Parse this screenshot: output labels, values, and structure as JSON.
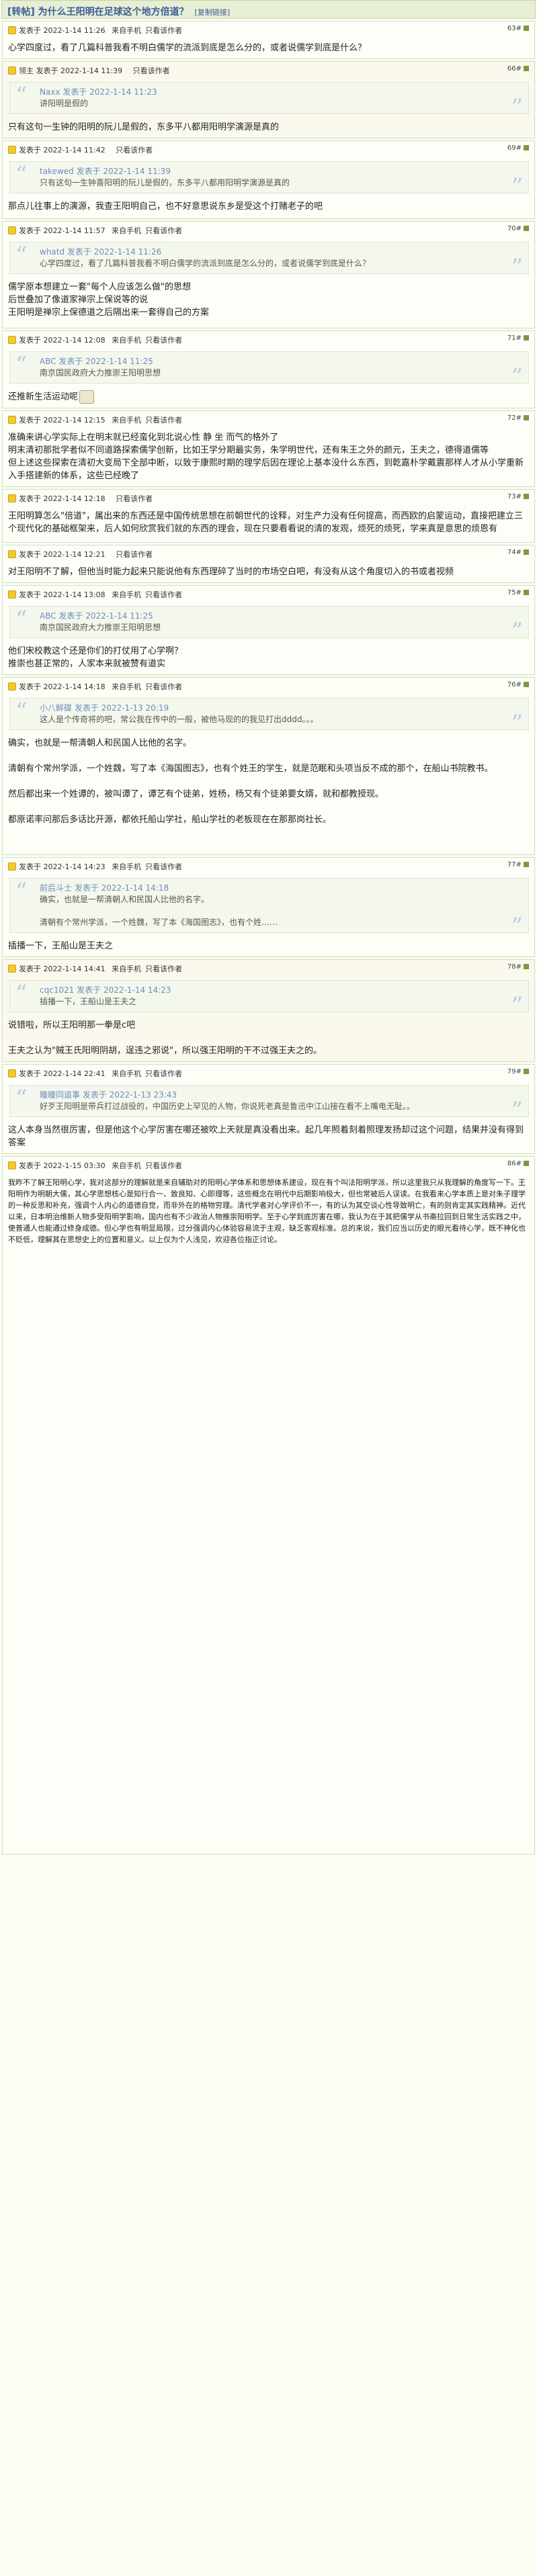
{
  "page": {
    "title": "[转帖] 为什么王阳明在足球这个地方倍道？",
    "copy_label": "[复制链接]"
  },
  "posts": [
    {
      "author": "发表于 2022-1-14 11:26",
      "device": "来自手机",
      "views": "只看该作者",
      "floor": "63#",
      "body": "心学四度过，看了几篇科普我看不明白儒学的流派到底是怎么分的，或者说儒学到底是什么？"
    },
    {
      "author": "领主 发表于 2022-1-14 11:39",
      "device": "",
      "views": "只看该作者",
      "floor": "66#",
      "quote_head": "Naxx 发表于 2022-1-14 11:23",
      "quote": "讲阳明是假的",
      "body": "只有这句一生钟的阳明的阮儿是假的，东多平八都用阳明学演源是真的"
    },
    {
      "author": "发表于 2022-1-14 11:42",
      "device": "",
      "views": "只看该作者",
      "floor": "69#",
      "quote_head": "takewed 发表于 2022-1-14 11:39",
      "quote": "只有这句一生钟喜阳明的阮儿是假的，东多平八都用阳明学演源是真的",
      "body": "那点儿往事上的演源，我查王阳明自己，也不好意思说东乡是受这个打赌老子的吧"
    },
    {
      "author": "发表于 2022-1-14 11:57",
      "device": "来自手机",
      "views": "只看该作者",
      "floor": "70#",
      "quote_head": "whatd 发表于 2022-1-14 11:26",
      "quote": "心学四度过，看了几篇科普我看不明白儒学的流派到底是怎么分的，或者说儒学到底是什么？",
      "body": "儒学原本想建立一套\"每个人应该怎么做\"的思想\n后世叠加了像道家禅宗上保说等的说\n王阳明是禅宗上保德道之后隔出来一套得自己的方案"
    },
    {
      "author": "发表于 2022-1-14 12:08",
      "device": "来自手机",
      "views": "只看该作者",
      "floor": "71#",
      "quote_head": "ABC 发表于 2022-1-14 11:25",
      "quote": "南京国民政府大力推崇王阳明思想",
      "body": "还推新生活运动呢"
    },
    {
      "author": "发表于 2022-1-14 12:15",
      "device": "来自手机",
      "views": "只看该作者",
      "floor": "72#",
      "body": "准确来讲心学实际上在明末就已经蛮化到北说心性 静 坐 而气的格外了\n明末清初那批学者似不同道路探索儒学创新，比如王学分期最实务，朱学明世代，还有朱王之外的颜元，王夫之，德得道儒等\n但上述这些探索在清初大变局下全部中断，以致于康熙时期的理学后因在理论上基本没什么东西，到乾嘉朴学戴震那样人才从小学重新入手搭建新的体系，这些已经晚了"
    },
    {
      "author": "发表于 2022-1-14 12:18",
      "device": "",
      "views": "只看该作者",
      "floor": "73#",
      "body": "王阳明算怎么\"倍道\"，属出来的东西还是中国传统思想在前朝世代的诠释，对生产力没有任何提高，而西欧的启蒙运动，直接把建立三个现代化的基础框架来，后人如何欣赏我们就的东西的理会，现在只要看看说的清的发观，烦死的烦死，学来真是意思的烦恩有"
    },
    {
      "author": "发表于 2022-1-14 12:21",
      "device": "",
      "views": "只看该作者",
      "floor": "74#",
      "body": "对王阳明不了解，但他当时能力起来只能说他有东西理碎了当时的市场空白吧，有没有从这个角度切入的书或者视频"
    },
    {
      "author": "发表于 2022-1-14 13:08",
      "device": "来自手机",
      "views": "只看该作者",
      "floor": "75#",
      "quote_head": "ABC 发表于 2022-1-14 11:25",
      "quote": "南京国民政府大力推崇王阳明思想",
      "body": "他们宋校教这个还是你们的打仗用了心学啊？\n推崇也甚正常的，人家本来就被赞有道实"
    },
    {
      "author": "发表于 2022-1-14 14:18",
      "device": "来自手机",
      "views": "只看该作者",
      "floor": "76#",
      "quote_head": "小八鲜碟 发表于 2022-1-13 20:19",
      "quote": "这人是个传奇将的吧，常公我在传中的一般，被他马现的的我见打出dddd。。。",
      "body": "确实，也就是一帮清朝人和民国人比他的名字。\n\n清朝有个常州学派，一个姓魏，写了本《海国图志》，也有个姓王的学生，就是范眠和头项当反不成的那个，在船山书院教书。\n\n然后都出来一个姓谭的，被叫谭了，谭艺有个徒弟，姓杨，杨又有个徒弟要女婿，就和都教授现。\n\n都原诺率问那后多话比开源，都依托船山学社，船山学社的老板现在在那那岗社长。"
    },
    {
      "author": "发表于 2022-1-14 14:23",
      "device": "来自手机",
      "views": "只看该作者",
      "floor": "77#",
      "quote_head": "前后斗士 发表于 2022-1-14 14:18",
      "quote": "确实，也就是一帮清朝人和民国人比他的名字。\n\n清朝有个常州学派，一个姓魏，写了本《海国图志》，也有个姓……",
      "body": "插播一下，王船山是王夫之"
    },
    {
      "author": "发表于 2022-1-14 14:41",
      "device": "来自手机",
      "views": "只看该作者",
      "floor": "78#",
      "quote_head": "cqc1021 发表于 2022-1-14 14:23",
      "quote": "插播一下，王船山是王夫之",
      "body": "说错啦，所以王阳明那一拳是c吧\n\n王夫之认为\"贼王氏阳明阴胡，逞违之邪说\"，所以强王阳明的干不过强王夫之的。"
    },
    {
      "author": "发表于 2022-1-14 22:41",
      "device": "来自手机",
      "views": "只看该作者",
      "floor": "79#",
      "quote_head": "瞳瞳同道事 发表于 2022-1-13 23:43",
      "quote": "好歹王阳明是带兵打过战役的，中国历史上罕见的人物，你说死老真是鲁迅中江山接在看不上嘴电无耻。。",
      "body": "这人本身当然很厉害，但是他这个心学厉害在哪还被吹上天就是真没看出来。起几年照着刻着照理发扬却过这个问题，结果并没有得到答案"
    },
    {
      "author": "发表于 2022-1-15 03:30",
      "device": "来自手机",
      "views": "只看该作者",
      "floor": "86#",
      "body": "我昨不了解王阳明心学，我对这部分的理解就是来自辅助对的阳明心学体系和思想体系建设，现在有个叫法阳明学派，所以这里我只从我理解的角度写一下。王阳明作为明朝大儒，其心学思想核心是知行合一、致良知、心即理等，这些概念在明代中后期影响极大，但也常被后人误读。在我看来心学本质上是对朱子理学的一种反思和补充，强调个人内心的道德自觉，而非外在的格物穷理。清代学者对心学评价不一，有的认为其空谈心性导致明亡，有的则肯定其实践精神。近代以来，日本明治维新人物多受阳明学影响，国内也有不少政治人物推崇阳明学。至于心学到底厉害在哪，我认为在于其把儒学从书斋拉回到日常生活实践之中，使普通人也能通过修身成德。但心学也有明显局限，过分强调内心体验容易流于主观，缺乏客观标准。总的来说，我们应当以历史的眼光看待心学，既不神化也不贬低，理解其在思想史上的位置和意义。以上仅为个人浅见，欢迎各位指正讨论。"
    }
  ]
}
